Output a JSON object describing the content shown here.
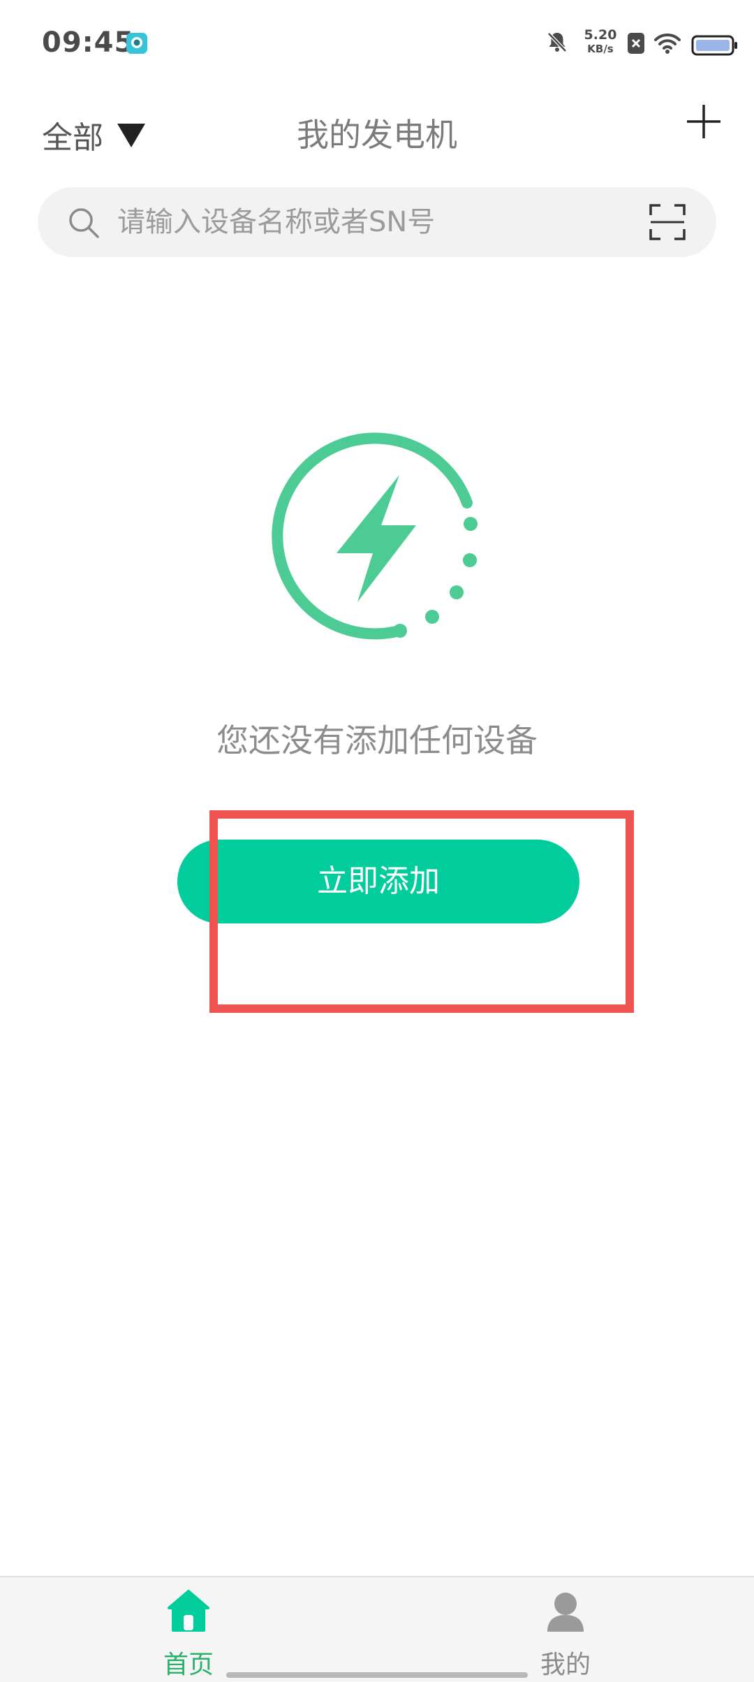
{
  "status_bar": {
    "time": "09:45",
    "net_speed_value": "5.20",
    "net_speed_unit": "KB/s",
    "icons": [
      "app-notification-icon",
      "mute-bell-icon",
      "sim-off-icon",
      "wifi-icon",
      "battery-icon"
    ]
  },
  "header": {
    "filter_label": "全部",
    "title": "我的发电机",
    "add_icon": "plus-icon"
  },
  "search": {
    "placeholder": "请输入设备名称或者SN号",
    "value": ""
  },
  "empty_state": {
    "message": "您还没有添加任何设备",
    "button_label": "立即添加"
  },
  "tabs": [
    {
      "label": "首页",
      "icon": "home-icon",
      "active": true
    },
    {
      "label": "我的",
      "icon": "profile-icon",
      "active": false
    }
  ],
  "colors": {
    "accent": "#00cc9c",
    "illustration": "#4ccc94",
    "active_tab": "#2ab069",
    "highlight": "#ef5350",
    "search_bg": "#f2f2f2"
  }
}
